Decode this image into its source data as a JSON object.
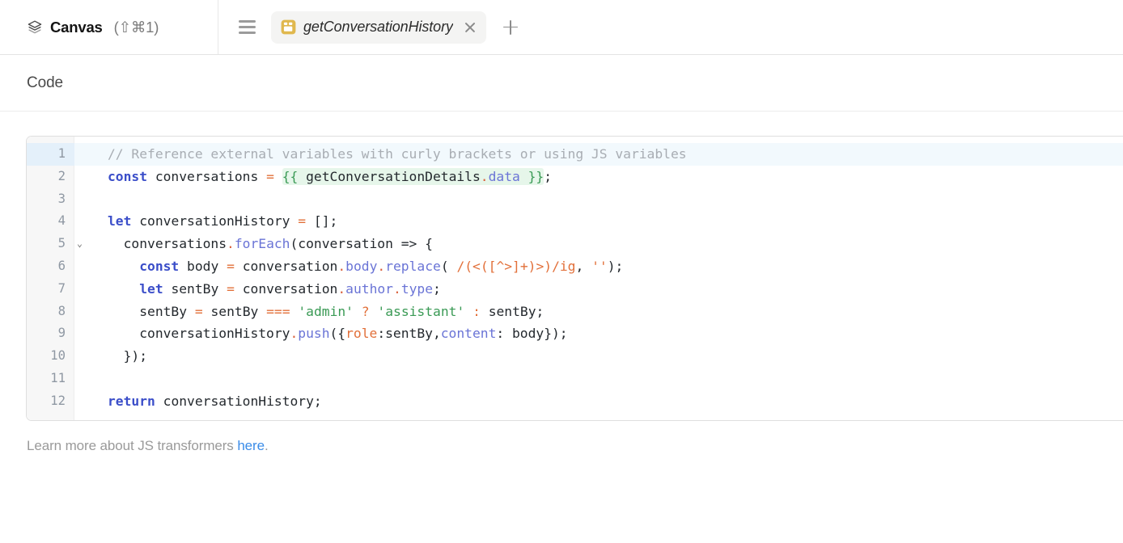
{
  "topbar": {
    "canvas": {
      "icon": "layers-icon",
      "label": "Canvas",
      "shortcut": "(⇧⌘1)"
    },
    "menu_icon": "hamburger-menu-icon",
    "tab": {
      "icon": "tool-block-icon",
      "title": "getConversationHistory",
      "close_icon": "close-icon"
    },
    "add_tab_icon": "plus-icon"
  },
  "section": {
    "title": "Code"
  },
  "editor": {
    "active_line": 1,
    "fold_marker": "⌄",
    "fold_line": 5,
    "lines": [
      {
        "n": "1",
        "html": "<span class='t-com'>// Reference external variables with curly brackets or using JS variables</span>"
      },
      {
        "n": "2",
        "html": "<span class='t-kw'>const</span> <span class='t-plain'>conversations</span> <span class='t-op'>=</span> <span class='hl-tpl'><span class='t-tpl'>{{</span> <span class='t-plain'>getConversationDetails</span><span class='t-dot'>.</span><span class='t-prop'>data</span> <span class='t-tpl'>}}</span></span><span class='t-plain'>;</span>"
      },
      {
        "n": "3",
        "html": ""
      },
      {
        "n": "4",
        "html": "<span class='t-kw'>let</span> <span class='t-plain'>conversationHistory</span> <span class='t-op'>=</span> <span class='t-plain'>[];</span>"
      },
      {
        "n": "5",
        "html": "  <span class='t-plain'>conversations</span><span class='t-dot'>.</span><span class='t-fn'>forEach</span><span class='t-plain'>(conversation =&gt; {</span>"
      },
      {
        "n": "6",
        "html": "    <span class='t-kw'>const</span> <span class='t-plain'>body</span> <span class='t-op'>=</span> <span class='t-plain'>conversation</span><span class='t-dot'>.</span><span class='t-prop'>body</span><span class='t-dot'>.</span><span class='t-fn'>replace</span><span class='t-plain'>(</span> <span class='t-op'>/(&lt;([^&gt;]+)&gt;)/ig</span><span class='t-plain'>,</span> <span class='t-op'>''</span><span class='t-plain'>);</span>"
      },
      {
        "n": "7",
        "html": "    <span class='t-kw'>let</span> <span class='t-plain'>sentBy</span> <span class='t-op'>=</span> <span class='t-plain'>conversation</span><span class='t-dot'>.</span><span class='t-prop'>author</span><span class='t-dot'>.</span><span class='t-prop'>type</span><span class='t-plain'>;</span>"
      },
      {
        "n": "8",
        "html": "    <span class='t-plain'>sentBy</span> <span class='t-op'>=</span> <span class='t-plain'>sentBy</span> <span class='t-op'>===</span> <span class='t-str'>'admin'</span> <span class='t-op'>?</span> <span class='t-str'>'assistant'</span> <span class='t-op'>:</span> <span class='t-plain'>sentBy;</span>"
      },
      {
        "n": "9",
        "html": "    <span class='t-plain'>conversationHistory</span><span class='t-dot'>.</span><span class='t-fn'>push</span><span class='t-plain'>({</span><span class='t-key'>role</span><span class='t-plain'>:sentBy,</span><span class='t-prop'>content</span><span class='t-plain'>: body});</span>"
      },
      {
        "n": "10",
        "html": "  <span class='t-plain'>});</span>"
      },
      {
        "n": "11",
        "html": ""
      },
      {
        "n": "12",
        "html": "<span class='t-kw'>return</span> <span class='t-plain'>conversationHistory;</span>"
      }
    ],
    "code_plain": [
      "// Reference external variables with curly brackets or using JS variables",
      "const conversations = {{ getConversationDetails.data }};",
      "",
      "let conversationHistory = [];",
      "  conversations.forEach(conversation => {",
      "    const body = conversation.body.replace( /(<([^>]+)>)/ig, '');",
      "    let sentBy = conversation.author.type;",
      "    sentBy = sentBy === 'admin' ? 'assistant' : sentBy;",
      "    conversationHistory.push({role:sentBy,content: body});",
      "  });",
      "",
      "return conversationHistory;"
    ]
  },
  "footer": {
    "text_before": "Learn more about JS transformers ",
    "link_label": "here",
    "text_after": "."
  },
  "colors": {
    "accent_link": "#3b8ce8",
    "tab_icon": "#e0b84e",
    "active_line": "#f2f9fd",
    "template_highlight": "#e6f6ea",
    "keyword": "#3b4ec9",
    "string": "#3a9a55",
    "operator": "#e2703a",
    "property": "#6a74d6",
    "comment": "#a8adb3"
  }
}
